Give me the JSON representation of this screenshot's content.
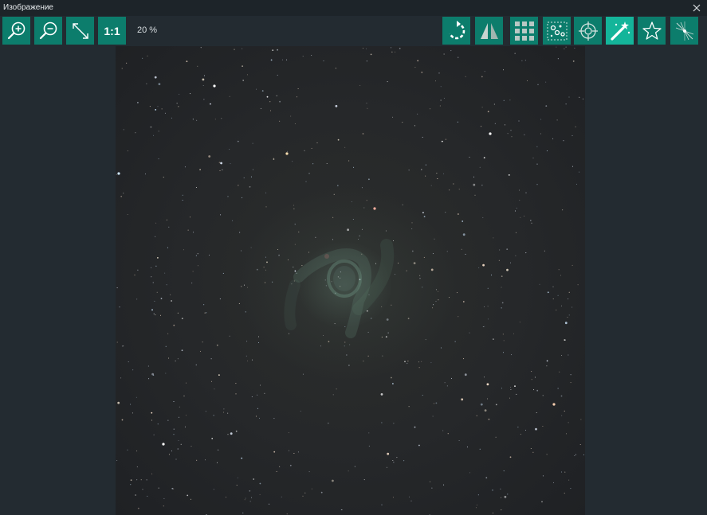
{
  "window": {
    "title": "Изображение",
    "close_icon": "close-icon"
  },
  "toolbar": {
    "zoom_in_icon": "zoom-in-icon",
    "zoom_out_icon": "zoom-out-icon",
    "fit_icon": "fit-to-window-icon",
    "actual_size_label": "1:1",
    "zoom_level": "20 %",
    "right_tools": [
      {
        "name": "rotate-icon"
      },
      {
        "name": "flip-icon"
      },
      {
        "name": "grid-icon"
      },
      {
        "name": "star-detection-icon"
      },
      {
        "name": "target-icon"
      },
      {
        "name": "auto-stretch-icon",
        "active": true
      },
      {
        "name": "star-icon"
      },
      {
        "name": "diffraction-icon"
      }
    ]
  },
  "colors": {
    "background": "#232b31",
    "button": "#0c7d6c",
    "button_active": "#14b59a",
    "nebula": "#6a9a86"
  },
  "image": {
    "subject": "star-field-nebula"
  }
}
